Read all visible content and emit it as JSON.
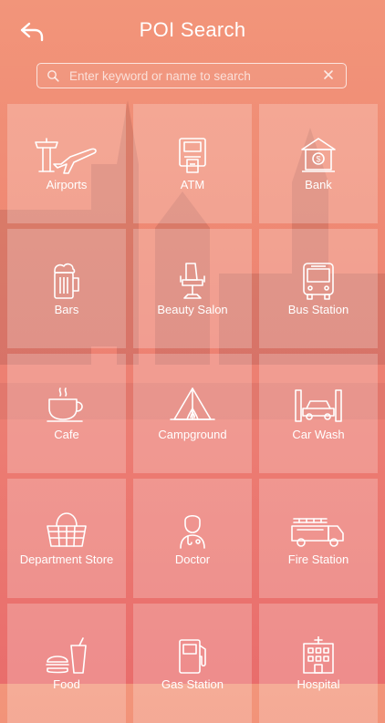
{
  "header": {
    "title": "POI Search",
    "back_icon": "back-arrow-icon"
  },
  "search": {
    "placeholder": "Enter keyword or name to search",
    "value": "",
    "clear_icon": "close-icon",
    "icon": "search-icon"
  },
  "categories": [
    {
      "label": "Airports",
      "icon": "airport-icon"
    },
    {
      "label": "ATM",
      "icon": "atm-icon"
    },
    {
      "label": "Bank",
      "icon": "bank-icon"
    },
    {
      "label": "Bars",
      "icon": "beer-mug-icon"
    },
    {
      "label": "Beauty Salon",
      "icon": "salon-chair-icon"
    },
    {
      "label": "Bus Station",
      "icon": "bus-icon"
    },
    {
      "label": "Cafe",
      "icon": "coffee-cup-icon"
    },
    {
      "label": "Campground",
      "icon": "tent-icon"
    },
    {
      "label": "Car Wash",
      "icon": "car-wash-icon"
    },
    {
      "label": "Department Store",
      "icon": "shopping-basket-icon"
    },
    {
      "label": "Doctor",
      "icon": "doctor-icon"
    },
    {
      "label": "Fire Station",
      "icon": "fire-truck-icon"
    },
    {
      "label": "Food",
      "icon": "fast-food-icon"
    },
    {
      "label": "Gas Station",
      "icon": "fuel-pump-icon"
    },
    {
      "label": "Hospital",
      "icon": "hospital-icon"
    }
  ]
}
